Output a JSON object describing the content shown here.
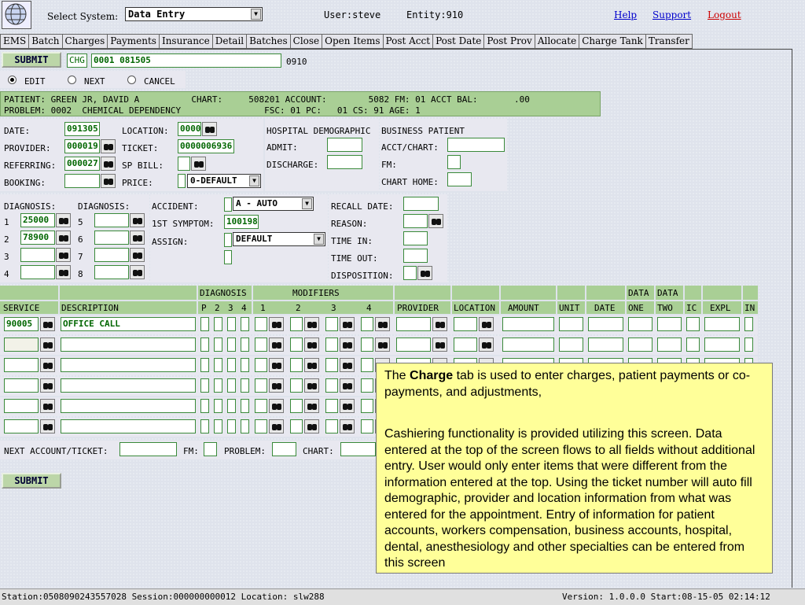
{
  "header": {
    "select_system_label": "Select System:",
    "select_system_value": "Data Entry",
    "user": "User:steve",
    "entity": "Entity:910",
    "links": [
      "Help",
      "Support",
      "Logout"
    ]
  },
  "tabs": [
    "EMS",
    "Batch",
    "Charges",
    "Payments",
    "Insurance",
    "Detail",
    "Batches",
    "Close",
    "Open Items",
    "Post Acct",
    "Post Date",
    "Post Prov",
    "Allocate",
    "Charge Tank",
    "Transfer"
  ],
  "toolbar": {
    "submit": "SUBMIT",
    "chg": "CHG",
    "chg_value": "0001 081505",
    "code": "0910"
  },
  "mode": {
    "edit": "EDIT",
    "next": "NEXT",
    "cancel": "CANCEL"
  },
  "patient": {
    "line1": "PATIENT: GREEN JR, DAVID A          CHART:     508201 ACCOUNT:        5082 FM: 01 ACCT BAL:       .00",
    "line2": "PROBLEM: 0002  CHEMICAL DEPENDENCY                FSC: 01 PC:   01 CS: 91 AGE: 1"
  },
  "visit": {
    "date_label": "DATE:",
    "date": "091305",
    "provider_label": "PROVIDER:",
    "provider": "000019",
    "referring_label": "REFERRING:",
    "referring": "000027",
    "booking_label": "BOOKING:",
    "location_label": "LOCATION:",
    "location": "0000",
    "ticket_label": "TICKET:",
    "ticket": "0000006936",
    "spbill_label": "SP BILL:",
    "price_label": "PRICE:",
    "price": "0-DEFAULT"
  },
  "hospital": {
    "title": "HOSPITAL DEMOGRAPHIC",
    "admit": "ADMIT:",
    "discharge": "DISCHARGE:"
  },
  "business": {
    "title": "BUSINESS PATIENT",
    "acct": "ACCT/CHART:",
    "fm": "FM:",
    "home": "CHART HOME:"
  },
  "diagnosis": {
    "label": "DIAGNOSIS:",
    "nums_left": [
      "1",
      "2",
      "3",
      "4"
    ],
    "nums_right": [
      "5",
      "6",
      "7",
      "8"
    ],
    "values_left": [
      "25000",
      "78900",
      "",
      ""
    ]
  },
  "accident": {
    "accident_label": "ACCIDENT:",
    "accident_value": "A - AUTO",
    "symptom_label": "1ST SYMPTOM:",
    "symptom_value": "100198",
    "assign_label": "ASSIGN:",
    "assign_value": "DEFAULT"
  },
  "recall": {
    "recall_date": "RECALL DATE:",
    "reason": "REASON:",
    "time_in": "TIME IN:",
    "time_out": "TIME OUT:",
    "disposition": "DISPOSITION:"
  },
  "grid": {
    "group_headers": {
      "diagnosis": "DIAGNOSIS",
      "modifiers": "MODIFIERS",
      "data1": "DATA",
      "data2": "DATA"
    },
    "columns": [
      "SERVICE",
      "DESCRIPTION",
      "P",
      "2",
      "3",
      "4",
      "1",
      "2",
      "3",
      "4",
      "PROVIDER",
      "LOCATION",
      "AMOUNT",
      "UNIT",
      "DATE",
      "ONE",
      "TWO",
      "IC",
      "EXPL",
      "IN"
    ],
    "rows": [
      {
        "service": "90005",
        "description": "OFFICE CALL"
      },
      {
        "service": "",
        "description": ""
      },
      {
        "service": "",
        "description": ""
      },
      {
        "service": "",
        "description": ""
      },
      {
        "service": "",
        "description": ""
      },
      {
        "service": "",
        "description": ""
      }
    ]
  },
  "next_row": {
    "next": "NEXT ACCOUNT/TICKET:",
    "fm": "FM:",
    "problem": "PROBLEM:",
    "chart": "CHART:"
  },
  "bottom_submit": "SUBMIT",
  "callout": {
    "p1_pre": "The ",
    "p1_bold": "Charge",
    "p1_post": " tab is used to enter charges, patient payments or co-payments, and adjustments,",
    "p2": "Cashiering functionality is provided utilizing this screen.  Data entered at the top of the screen flows to all fields without additional entry.  User would only enter items that were different from the information entered at the top.  Using the ticket number will auto fill demographic, provider and location information from what was entered for the appointment.  Entry of information for patient accounts, workers compensation, business accounts, hospital, dental, anesthesiology and other specialties can be entered from this screen"
  },
  "status": {
    "left": "Station:0508090243557028 Session:000000000012 Location: slw288",
    "right": "Version: 1.0.0.0 Start:08-15-05 02:14:12"
  }
}
